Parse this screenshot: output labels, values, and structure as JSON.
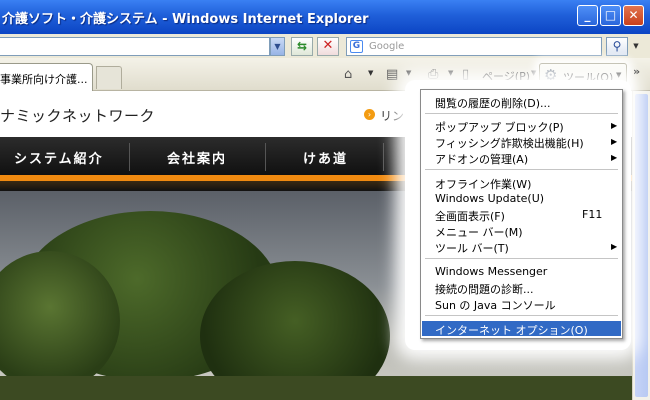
{
  "window": {
    "title": "介護ソフト・介護システム - Windows Internet Explorer",
    "min": "_",
    "max": "□",
    "close": "✕"
  },
  "address_bar": {
    "search_placeholder": "Google",
    "search_logo": "G"
  },
  "tabs": [
    {
      "label": "事業所向け介護..."
    }
  ],
  "command_bar": {
    "page_label": "ページ(P)",
    "tools_label": "ツール(O)",
    "more": "»"
  },
  "site": {
    "name": "ナミックネットワーク",
    "link_text": "リンク集",
    "nav": [
      "システム紹介",
      "会社案内",
      "けあ道"
    ]
  },
  "tools_menu": {
    "groups": [
      [
        {
          "label": "閲覧の履歴の削除(D)..."
        }
      ],
      [
        {
          "label": "ポップアップ ブロック(P)",
          "submenu": true
        },
        {
          "label": "フィッシング詐欺検出機能(H)",
          "submenu": true
        },
        {
          "label": "アドオンの管理(A)",
          "submenu": true
        }
      ],
      [
        {
          "label": "オフライン作業(W)"
        },
        {
          "label": "Windows Update(U)"
        },
        {
          "label": "全画面表示(F)",
          "shortcut": "F11"
        },
        {
          "label": "メニュー バー(M)"
        },
        {
          "label": "ツール バー(T)",
          "submenu": true
        }
      ],
      [
        {
          "label": "Windows Messenger"
        },
        {
          "label": "接続の問題の診断..."
        },
        {
          "label": "Sun の Java コンソール"
        }
      ],
      [
        {
          "label": "インターネット オプション(O)",
          "highlighted": true
        }
      ]
    ]
  },
  "colors": {
    "titlebar": "#1f5fd9",
    "menu_highlight": "#316ac5",
    "site_accent": "#f08a10"
  }
}
